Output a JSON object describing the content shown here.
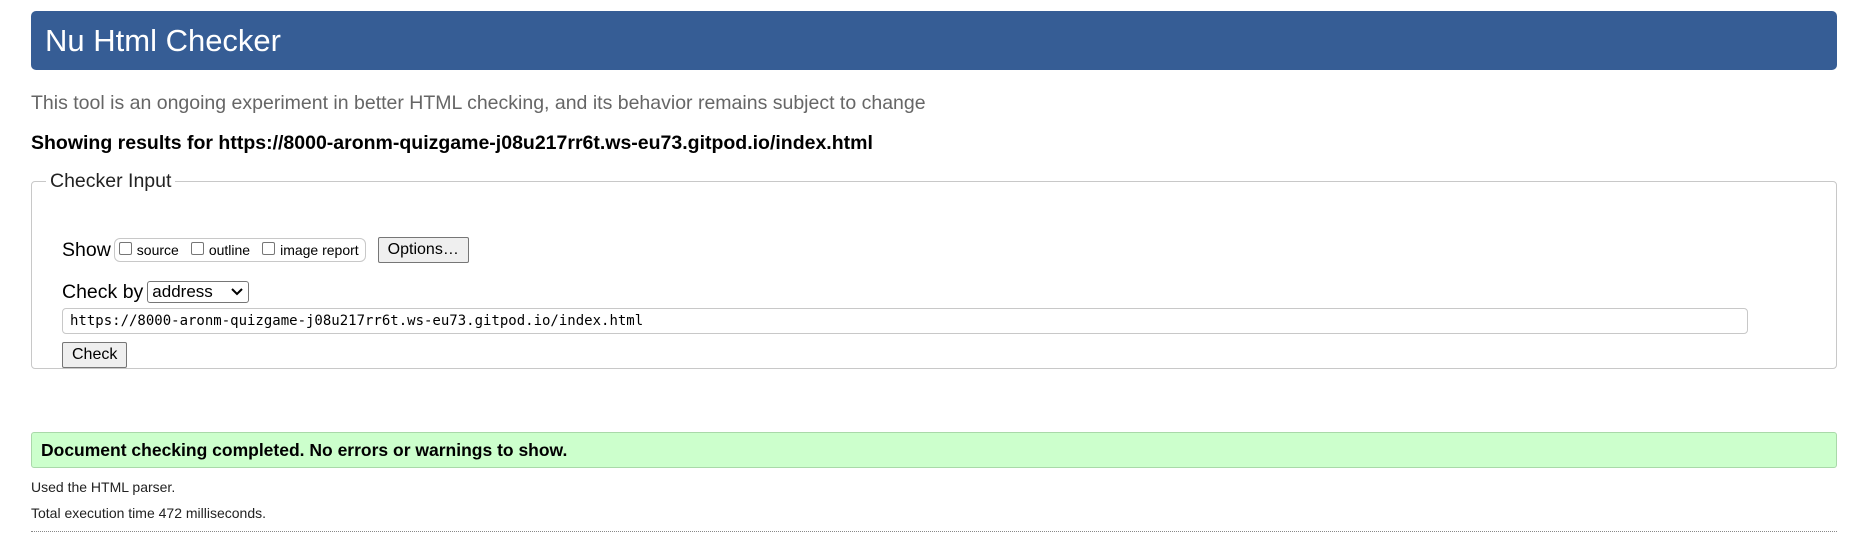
{
  "header": {
    "title": "Nu Html Checker",
    "background_color": "#365d95"
  },
  "intro": "This tool is an ongoing experiment in better HTML checking, and its behavior remains subject to change",
  "showing": "Showing results for https://8000-aronm-quizgame-j08u217rr6t.ws-eu73.gitpod.io/index.html",
  "checker": {
    "legend": "Checker Input",
    "show_label": "Show",
    "options": [
      {
        "label": "source",
        "checked": false
      },
      {
        "label": "outline",
        "checked": false
      },
      {
        "label": "image report",
        "checked": false
      }
    ],
    "options_button": "Options…",
    "check_by_label": "Check by",
    "check_by_value": "address",
    "url_value": "https://8000-aronm-quizgame-j08u217rr6t.ws-eu73.gitpod.io/index.html",
    "check_button": "Check"
  },
  "result": {
    "message": "Document checking completed. No errors or warnings to show.",
    "background_color": "#ccffcc"
  },
  "stats": {
    "parser": "Used the HTML parser.",
    "time": "Total execution time 472 milliseconds."
  }
}
